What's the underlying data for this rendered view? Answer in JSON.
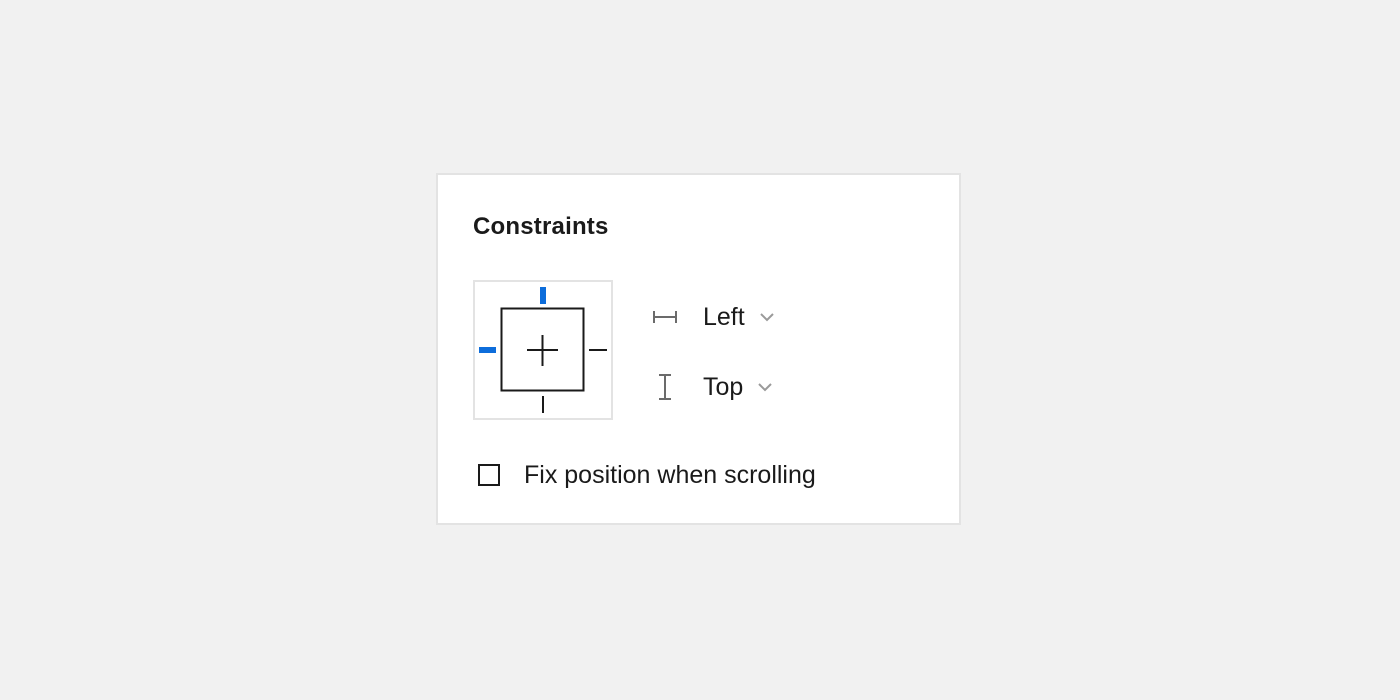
{
  "panel": {
    "title": "Constraints"
  },
  "constraint_widget": {
    "active_horizontal": "left",
    "active_vertical": "top",
    "active_color": "#0d6ddb",
    "inactive_color": "#1a1a1a"
  },
  "horizontal": {
    "icon": "horizontal-constraint-icon",
    "value": "Left",
    "chevron_icon": "chevron-down-icon"
  },
  "vertical": {
    "icon": "vertical-constraint-icon",
    "value": "Top",
    "chevron_icon": "chevron-down-icon"
  },
  "fix_position": {
    "label": "Fix position when scrolling",
    "checked": false
  }
}
